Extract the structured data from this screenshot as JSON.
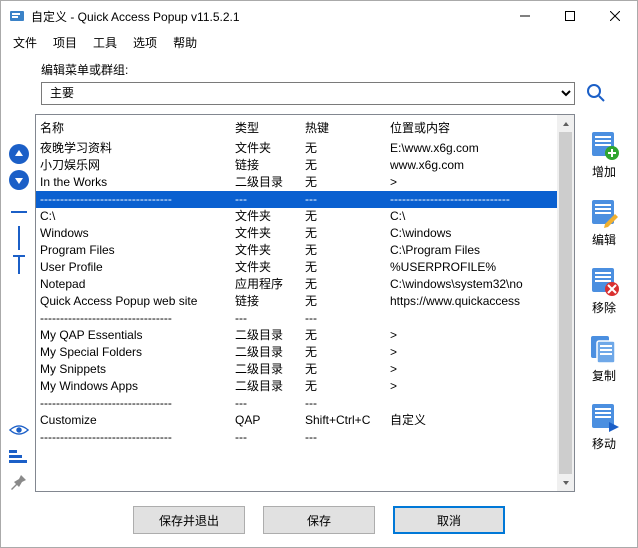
{
  "window": {
    "title": "自定义 - Quick Access Popup v11.5.2.1"
  },
  "menu": {
    "items": [
      "文件",
      "项目",
      "工具",
      "选项",
      "帮助"
    ]
  },
  "group": {
    "label": "编辑菜单或群组:",
    "selected": "主要"
  },
  "columns": {
    "name": "名称",
    "type": "类型",
    "hotkey": "热键",
    "location": "位置或内容"
  },
  "rows": [
    {
      "name": "夜晚学习资料",
      "type": "文件夹",
      "hotkey": "无",
      "loc": "E:\\www.x6g.com"
    },
    {
      "name": "小刀娱乐网",
      "type": "链接",
      "hotkey": "无",
      "loc": "www.x6g.com"
    },
    {
      "name": "In the Works",
      "type": "二级目录",
      "hotkey": "无",
      "loc": ">"
    },
    {
      "name": "---------------------------------",
      "type": "---",
      "hotkey": "---",
      "loc": "------------------------------",
      "selected": true
    },
    {
      "name": "C:\\",
      "type": "文件夹",
      "hotkey": "无",
      "loc": "C:\\"
    },
    {
      "name": "Windows",
      "type": "文件夹",
      "hotkey": "无",
      "loc": "C:\\windows"
    },
    {
      "name": "Program Files",
      "type": "文件夹",
      "hotkey": "无",
      "loc": "C:\\Program Files"
    },
    {
      "name": "User Profile",
      "type": "文件夹",
      "hotkey": "无",
      "loc": "%USERPROFILE%"
    },
    {
      "name": "Notepad",
      "type": "应用程序",
      "hotkey": "无",
      "loc": "C:\\windows\\system32\\no"
    },
    {
      "name": "Quick Access Popup web site",
      "type": "链接",
      "hotkey": "无",
      "loc": "https://www.quickaccess"
    },
    {
      "name": "---------------------------------",
      "type": "---",
      "hotkey": "---",
      "loc": ""
    },
    {
      "name": "My QAP Essentials",
      "type": "二级目录",
      "hotkey": "无",
      "loc": ">"
    },
    {
      "name": "My Special Folders",
      "type": "二级目录",
      "hotkey": "无",
      "loc": ">"
    },
    {
      "name": "My Snippets",
      "type": "二级目录",
      "hotkey": "无",
      "loc": ">"
    },
    {
      "name": "My Windows Apps",
      "type": "二级目录",
      "hotkey": "无",
      "loc": ">"
    },
    {
      "name": "---------------------------------",
      "type": "---",
      "hotkey": "---",
      "loc": ""
    },
    {
      "name": "Customize",
      "type": "QAP",
      "hotkey": "Shift+Ctrl+C",
      "loc": "自定义"
    },
    {
      "name": "---------------------------------",
      "type": "---",
      "hotkey": "---",
      "loc": ""
    }
  ],
  "actions": {
    "add": "增加",
    "edit": "编辑",
    "remove": "移除",
    "copy": "复制",
    "move": "移动"
  },
  "footer": {
    "save_exit": "保存并退出",
    "save": "保存",
    "cancel": "取消"
  },
  "icons": {
    "app": "app-icon",
    "minimize": "minimize-icon",
    "maximize": "maximize-icon",
    "close": "close-icon",
    "search": "search-icon",
    "up": "up-arrow-icon",
    "down": "down-arrow-icon",
    "hsep": "separator-icon",
    "vsep": "column-separator-icon",
    "text": "text-column-icon",
    "eye": "eye-icon",
    "steps": "sort-icon",
    "pin": "pin-icon"
  }
}
